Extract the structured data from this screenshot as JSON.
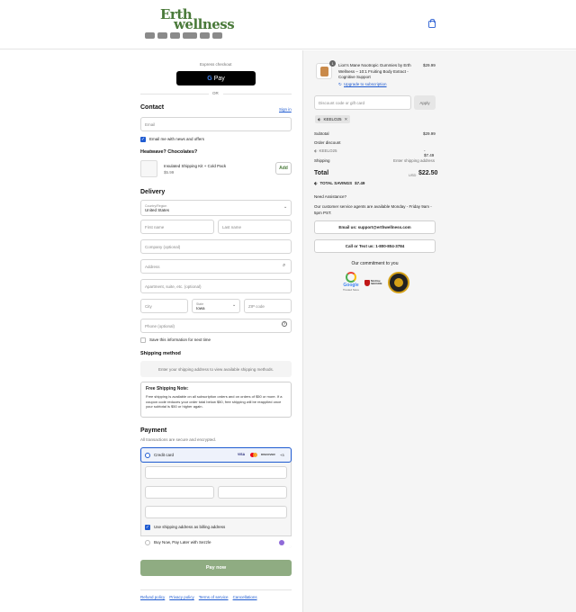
{
  "header": {
    "logo_line1": "Erth",
    "logo_line2": "wellness"
  },
  "express": {
    "label": "Express checkout",
    "gpay_label": "Pay",
    "or_label": "OR"
  },
  "contact": {
    "title": "Contact",
    "sign_in": "Sign in",
    "email_placeholder": "Email",
    "news_label": "Email me with news and offers",
    "upsell_title": "Heatwave? Chocolates?",
    "upsell_name": "Insulated Shipping Kit + Cold Pack",
    "upsell_price": "$5.99",
    "upsell_add": "Add"
  },
  "delivery": {
    "title": "Delivery",
    "country_label": "Country/Region",
    "country_value": "United States",
    "first_name": "First name",
    "last_name": "Last name",
    "company": "Company (optional)",
    "address": "Address",
    "apartment": "Apartment, suite, etc. (optional)",
    "city": "City",
    "state_label": "State",
    "state_value": "Iowa",
    "zip": "ZIP code",
    "phone": "Phone (optional)",
    "save_info": "Save this information for next time"
  },
  "shipping": {
    "title": "Shipping method",
    "placeholder": "Enter your shipping address to view available shipping methods.",
    "note_title": "Free Shipping Note:",
    "note_body": "Free shipping is available on all subscription orders and on orders of $50 or more. If a coupon code reduces your order total below $50, free shipping will be reapplied once your subtotal is $50 or higher again."
  },
  "payment": {
    "title": "Payment",
    "subtitle": "All transactions are secure and encrypted.",
    "credit_card": "Credit card",
    "card_brands": [
      "VISA",
      "",
      "DISCOVER",
      "+3"
    ],
    "billing_label": "Use shipping address as billing address",
    "sezzle_label": "Buy Now, Pay Later with Sezzle",
    "pay_button": "Pay now",
    "footer_links": [
      "Refund policy",
      "Privacy policy",
      "Terms of service",
      "Cancellations"
    ]
  },
  "summary": {
    "item_qty": "1",
    "item_title": "Lion's Mane Nootropic Gummies by Erth Wellness – 10:1 Fruiting Body Extract - Cognitive Support",
    "item_price": "$29.99",
    "upgrade": "Upgrade to subscription",
    "discount_placeholder": "Discount code or gift card",
    "apply": "Apply",
    "code_tag": "KEELO25",
    "subtotal_label": "Subtotal",
    "subtotal_value": "$29.99",
    "order_discount_label": "Order discount",
    "discount_code": "KEELO25",
    "discount_value": "- $7.49",
    "shipping_label": "Shipping",
    "shipping_value": "Enter shipping address",
    "total_label": "Total",
    "total_currency": "USD",
    "total_value": "$22.50",
    "savings_label": "TOTAL SAVINGS",
    "savings_value": "$7.49",
    "assist_title": "Need Assistance?",
    "assist_body": "Our customer service agents are available Monday - Friday 9am - 5pm PST.",
    "email_button": "Email us: support@erthwellness.com",
    "call_button": "Call or Text us: 1-800-804-3784",
    "commitment": "Our commitment to you",
    "google_label": "Google",
    "google_sub": "Trusted Store",
    "mcafee_label": "McAfee SECURE"
  }
}
